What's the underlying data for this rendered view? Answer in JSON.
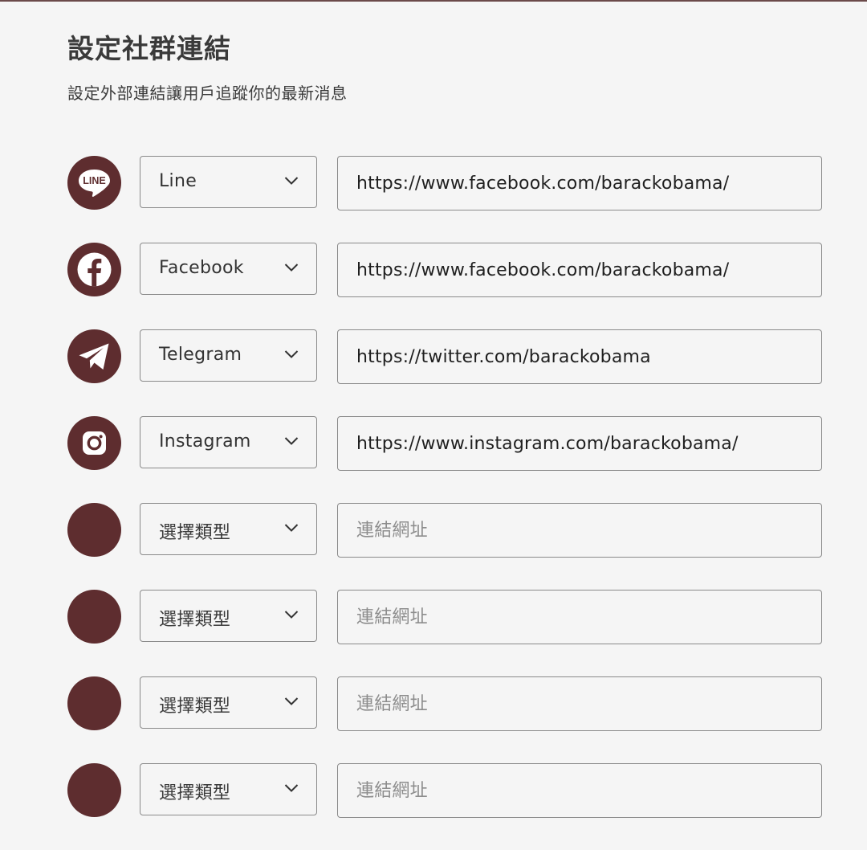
{
  "header": {
    "title": "設定社群連結",
    "subtitle": "設定外部連結讓用戶追蹤你的最新消息"
  },
  "colors": {
    "accent": "#5e2d2f",
    "background": "#f5f5f5",
    "border": "#8a8a8a"
  },
  "rows": [
    {
      "icon": "line-icon",
      "icon_text": "LINE",
      "type": "Line",
      "url": "https://www.facebook.com/barackobama/",
      "placeholder": ""
    },
    {
      "icon": "facebook-icon",
      "type": "Facebook",
      "url": "https://www.facebook.com/barackobama/",
      "placeholder": ""
    },
    {
      "icon": "telegram-icon",
      "type": "Telegram",
      "url": "https://twitter.com/barackobama",
      "placeholder": ""
    },
    {
      "icon": "instagram-icon",
      "type": "Instagram",
      "url": "https://www.instagram.com/barackobama/",
      "placeholder": ""
    },
    {
      "icon": "empty-icon",
      "type": "選擇類型",
      "url": "",
      "placeholder": "連結網址"
    },
    {
      "icon": "empty-icon",
      "type": "選擇類型",
      "url": "",
      "placeholder": "連結網址"
    },
    {
      "icon": "empty-icon",
      "type": "選擇類型",
      "url": "",
      "placeholder": "連結網址"
    },
    {
      "icon": "empty-icon",
      "type": "選擇類型",
      "url": "",
      "placeholder": "連結網址"
    }
  ]
}
